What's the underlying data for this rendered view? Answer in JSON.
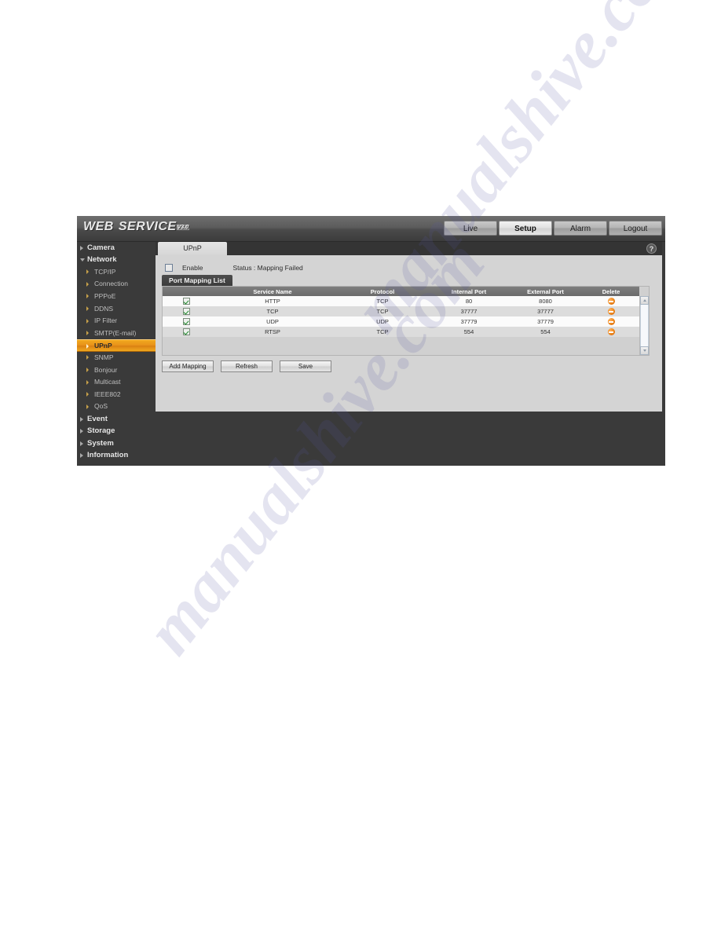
{
  "app": {
    "logo_primary": "WEB",
    "logo_secondary": "SERVICE",
    "logo_version": "V3.0"
  },
  "topnav": {
    "items": [
      {
        "label": "Live",
        "active": false
      },
      {
        "label": "Setup",
        "active": true
      },
      {
        "label": "Alarm",
        "active": false
      },
      {
        "label": "Logout",
        "active": false
      }
    ]
  },
  "sidebar": {
    "groups": [
      {
        "label": "Camera",
        "open": false,
        "children": []
      },
      {
        "label": "Network",
        "open": true,
        "children": [
          {
            "label": "TCP/IP",
            "selected": false
          },
          {
            "label": "Connection",
            "selected": false
          },
          {
            "label": "PPPoE",
            "selected": false
          },
          {
            "label": "DDNS",
            "selected": false
          },
          {
            "label": "IP Filter",
            "selected": false
          },
          {
            "label": "SMTP(E-mail)",
            "selected": false
          },
          {
            "label": "UPnP",
            "selected": true
          },
          {
            "label": "SNMP",
            "selected": false
          },
          {
            "label": "Bonjour",
            "selected": false
          },
          {
            "label": "Multicast",
            "selected": false
          },
          {
            "label": "IEEE802",
            "selected": false
          },
          {
            "label": "QoS",
            "selected": false
          }
        ]
      },
      {
        "label": "Event",
        "open": false,
        "children": []
      },
      {
        "label": "Storage",
        "open": false,
        "children": []
      },
      {
        "label": "System",
        "open": false,
        "children": []
      },
      {
        "label": "Information",
        "open": false,
        "children": []
      }
    ]
  },
  "content": {
    "tab_label": "UPnP",
    "help_icon": "question-mark-icon",
    "enable_label": "Enable",
    "enable_checked": false,
    "status_label": "Status : Mapping Failed",
    "section_title": "Port Mapping List"
  },
  "table": {
    "columns": [
      "",
      "Service Name",
      "Protocol",
      "Internal Port",
      "External Port",
      "Delete"
    ],
    "rows": [
      {
        "enabled": true,
        "service_name": "HTTP",
        "protocol": "TCP",
        "internal_port": "80",
        "external_port": "8080"
      },
      {
        "enabled": true,
        "service_name": "TCP",
        "protocol": "TCP",
        "internal_port": "37777",
        "external_port": "37777"
      },
      {
        "enabled": true,
        "service_name": "UDP",
        "protocol": "UDP",
        "internal_port": "37779",
        "external_port": "37779"
      },
      {
        "enabled": true,
        "service_name": "RTSP",
        "protocol": "TCP",
        "internal_port": "554",
        "external_port": "554"
      }
    ]
  },
  "buttons": {
    "add_mapping": "Add Mapping",
    "refresh": "Refresh",
    "save": "Save"
  },
  "watermark": {
    "line1": "manualshive.com",
    "line2": "manualshive.com"
  },
  "colors": {
    "accent_orange": "#e8911a",
    "window_dark": "#3a3a3a",
    "panel_gray": "#d4d4d4",
    "header_gray": "#6b6b6b",
    "delete_icon": "#f08b20"
  }
}
